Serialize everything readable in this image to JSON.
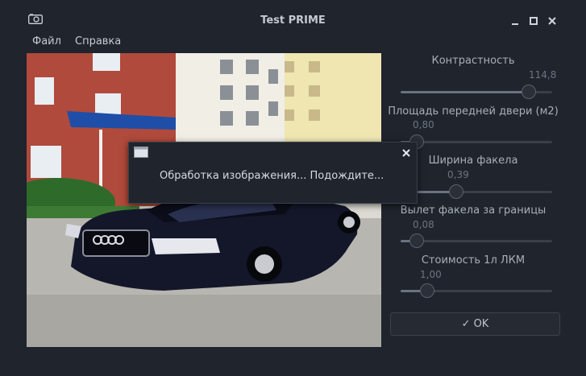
{
  "window": {
    "title": "Test PRIME"
  },
  "menu": {
    "file": "Файл",
    "help": "Справка"
  },
  "params": [
    {
      "label": "Контрастность",
      "value": "114,8",
      "fraction": 0.94
    },
    {
      "label": "Площадь передней двери (м2)",
      "value": "0,80",
      "fraction": 0.0
    },
    {
      "label": "Ширина факела",
      "value": "0,39",
      "fraction": 0.33
    },
    {
      "label": "Вылет факела за границы",
      "value": "0,08",
      "fraction": 0.0
    },
    {
      "label": "Стоимость 1л ЛКМ",
      "value": "1,00",
      "fraction": 0.09
    }
  ],
  "ok_button": {
    "label": "OK",
    "icon": "check-icon"
  },
  "dialog": {
    "text": "Обработка изображения... Подождите...",
    "icon": "window-icon"
  },
  "image": {
    "subject": "photo-of-dark-blue-car-in-front-of-buildings"
  }
}
